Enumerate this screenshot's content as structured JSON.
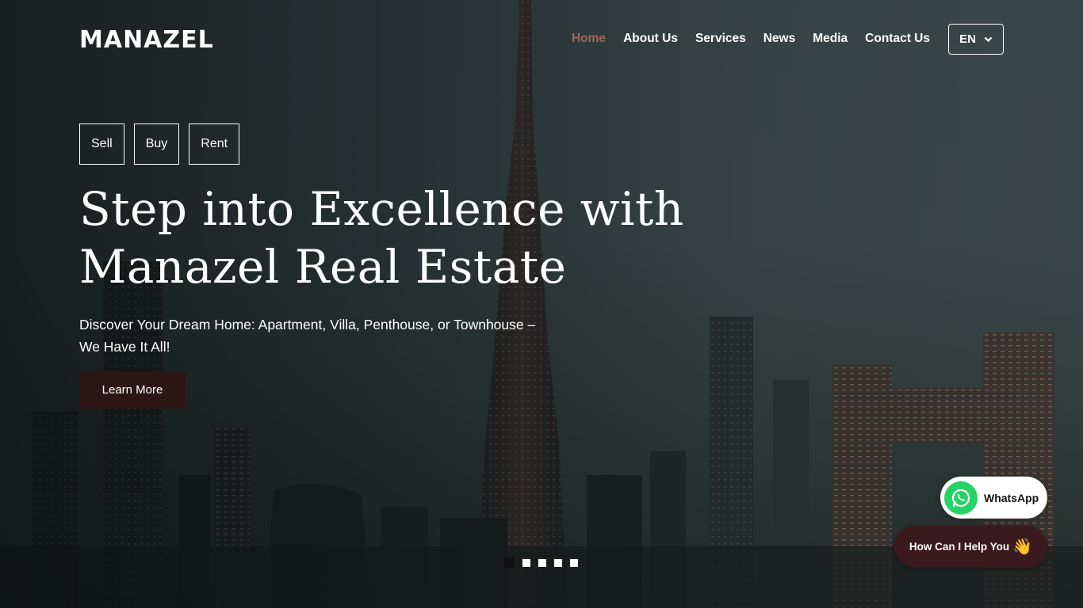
{
  "brand": {
    "logo_text": "MANAZEL"
  },
  "nav": {
    "items": [
      {
        "label": "Home",
        "active": true
      },
      {
        "label": "About Us",
        "active": false
      },
      {
        "label": "Services",
        "active": false
      },
      {
        "label": "News",
        "active": false
      },
      {
        "label": "Media",
        "active": false
      },
      {
        "label": "Contact Us",
        "active": false
      }
    ],
    "language": {
      "value": "EN",
      "icon": "chevron-down-icon"
    }
  },
  "hero": {
    "tabs": [
      "Sell",
      "Buy",
      "Rent"
    ],
    "headline_line1": "Step into Excellence with",
    "headline_line2": "Manazel Real Estate",
    "subtitle": "Discover Your Dream Home: Apartment, Villa, Penthouse, or Townhouse – We Have It All!",
    "cta_label": "Learn More"
  },
  "slider": {
    "total": 5,
    "active_index": 0
  },
  "widgets": {
    "whatsapp_label": "WhatsApp",
    "whatsapp_icon": "whatsapp-icon",
    "help_label": "How Can I Help You",
    "help_emoji": "👋"
  },
  "colors": {
    "active_nav": "#a0675a",
    "cta_bg": "#2d1616",
    "help_bg": "#3a1a1f",
    "whatsapp_green": "#25d366"
  }
}
